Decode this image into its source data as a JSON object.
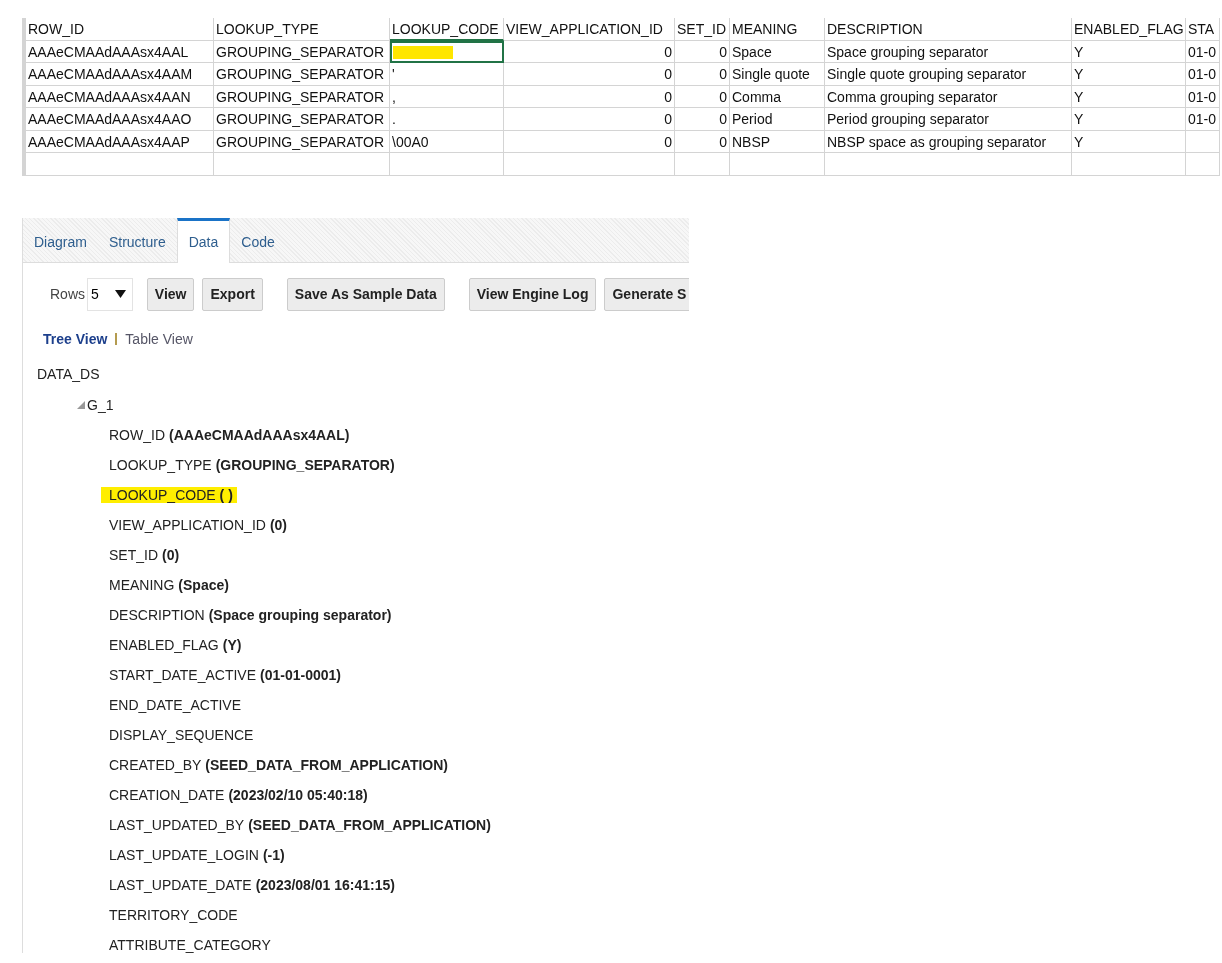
{
  "sheet": {
    "columns": [
      {
        "label": "ROW_ID",
        "kind": "text",
        "selected": false
      },
      {
        "label": "LOOKUP_TYPE",
        "kind": "text",
        "selected": false
      },
      {
        "label": "LOOKUP_CODE",
        "kind": "text",
        "selected": true
      },
      {
        "label": "VIEW_APPLICATION_ID",
        "kind": "number",
        "selected": false
      },
      {
        "label": "SET_ID",
        "kind": "number",
        "selected": false
      },
      {
        "label": "MEANING",
        "kind": "text",
        "selected": false
      },
      {
        "label": "DESCRIPTION",
        "kind": "text",
        "selected": false
      },
      {
        "label": "ENABLED_FLAG",
        "kind": "text",
        "selected": false
      },
      {
        "label": "STA",
        "kind": "text",
        "selected": false
      }
    ],
    "rows": [
      {
        "cells": [
          {
            "text": "AAAeCMAAdAAAsx4AAL",
            "selected": false,
            "highlighted": false
          },
          {
            "text": "GROUPING_SEPARATOR",
            "selected": false,
            "highlighted": false
          },
          {
            "selected": true,
            "highlighted": true
          },
          {
            "text": "0",
            "selected": false,
            "highlighted": false
          },
          {
            "text": "0",
            "selected": false,
            "highlighted": false
          },
          {
            "text": "Space",
            "selected": false,
            "highlighted": false
          },
          {
            "text": "Space grouping separator",
            "selected": false,
            "highlighted": false
          },
          {
            "text": "Y",
            "selected": false,
            "highlighted": false
          },
          {
            "text": "01-0",
            "selected": false,
            "highlighted": false
          }
        ]
      },
      {
        "cells": [
          {
            "text": "AAAeCMAAdAAAsx4AAM",
            "selected": false,
            "highlighted": false
          },
          {
            "text": "GROUPING_SEPARATOR",
            "selected": false,
            "highlighted": false
          },
          {
            "text": "'",
            "selected": false,
            "highlighted": false
          },
          {
            "text": "0",
            "selected": false,
            "highlighted": false
          },
          {
            "text": "0",
            "selected": false,
            "highlighted": false
          },
          {
            "text": "Single quote",
            "selected": false,
            "highlighted": false
          },
          {
            "text": "Single quote grouping separator",
            "selected": false,
            "highlighted": false
          },
          {
            "text": "Y",
            "selected": false,
            "highlighted": false
          },
          {
            "text": "01-0",
            "selected": false,
            "highlighted": false
          }
        ]
      },
      {
        "cells": [
          {
            "text": "AAAeCMAAdAAAsx4AAN",
            "selected": false,
            "highlighted": false
          },
          {
            "text": "GROUPING_SEPARATOR",
            "selected": false,
            "highlighted": false
          },
          {
            "text": ",",
            "selected": false,
            "highlighted": false
          },
          {
            "text": "0",
            "selected": false,
            "highlighted": false
          },
          {
            "text": "0",
            "selected": false,
            "highlighted": false
          },
          {
            "text": "Comma",
            "selected": false,
            "highlighted": false
          },
          {
            "text": "Comma grouping separator",
            "selected": false,
            "highlighted": false
          },
          {
            "text": "Y",
            "selected": false,
            "highlighted": false
          },
          {
            "text": "01-0",
            "selected": false,
            "highlighted": false
          }
        ]
      },
      {
        "cells": [
          {
            "text": "AAAeCMAAdAAAsx4AAO",
            "selected": false,
            "highlighted": false
          },
          {
            "text": "GROUPING_SEPARATOR",
            "selected": false,
            "highlighted": false
          },
          {
            "text": ".",
            "selected": false,
            "highlighted": false
          },
          {
            "text": "0",
            "selected": false,
            "highlighted": false
          },
          {
            "text": "0",
            "selected": false,
            "highlighted": false
          },
          {
            "text": "Period",
            "selected": false,
            "highlighted": false
          },
          {
            "text": "Period grouping separator",
            "selected": false,
            "highlighted": false
          },
          {
            "text": "Y",
            "selected": false,
            "highlighted": false
          },
          {
            "text": "01-0",
            "selected": false,
            "highlighted": false
          }
        ]
      },
      {
        "cells": [
          {
            "text": "AAAeCMAAdAAAsx4AAP",
            "selected": false,
            "highlighted": false
          },
          {
            "text": "GROUPING_SEPARATOR",
            "selected": false,
            "highlighted": false
          },
          {
            "text": "\\00A0",
            "selected": false,
            "highlighted": false
          },
          {
            "text": "0",
            "selected": false,
            "highlighted": false
          },
          {
            "text": "0",
            "selected": false,
            "highlighted": false
          },
          {
            "text": "NBSP",
            "selected": false,
            "highlighted": false
          },
          {
            "text": "NBSP space as grouping separator",
            "selected": false,
            "highlighted": false
          },
          {
            "text": "Y",
            "selected": false,
            "highlighted": false
          },
          {
            "selected": false,
            "highlighted": false
          }
        ]
      }
    ]
  },
  "tabs": [
    {
      "label": "Diagram",
      "selected": false
    },
    {
      "label": "Structure",
      "selected": false
    },
    {
      "label": "Data",
      "selected": true
    },
    {
      "label": "Code",
      "selected": false
    }
  ],
  "toolbar": {
    "rows_label": "Rows",
    "rows_value": "5",
    "items": [
      {
        "kind": "button",
        "label": "View"
      },
      {
        "kind": "button",
        "label": "Export"
      },
      {
        "kind": "separator"
      },
      {
        "kind": "button",
        "label": "Save As Sample Data"
      },
      {
        "kind": "separator"
      },
      {
        "kind": "button",
        "label": "View Engine Log"
      },
      {
        "kind": "button",
        "label": "Generate S"
      }
    ]
  },
  "views": [
    {
      "label": "Tree View",
      "selected": true
    },
    {
      "label": "Table View",
      "selected": false
    }
  ],
  "tree": {
    "label": "DATA_DS",
    "children": [
      {
        "label": "G_1",
        "expanded": true,
        "fields": [
          {
            "name": "ROW_ID",
            "value": "(AAAeCMAAdAAAsx4AAL)",
            "highlighted": false
          },
          {
            "name": "LOOKUP_TYPE",
            "value": "(GROUPING_SEPARATOR)",
            "highlighted": false
          },
          {
            "name": "LOOKUP_CODE",
            "value": "( )",
            "highlighted": true
          },
          {
            "name": "VIEW_APPLICATION_ID",
            "value": "(0)",
            "highlighted": false
          },
          {
            "name": "SET_ID",
            "value": "(0)",
            "highlighted": false
          },
          {
            "name": "MEANING",
            "value": "(Space)",
            "highlighted": false
          },
          {
            "name": "DESCRIPTION",
            "value": "(Space grouping separator)",
            "highlighted": false
          },
          {
            "name": "ENABLED_FLAG",
            "value": "(Y)",
            "highlighted": false
          },
          {
            "name": "START_DATE_ACTIVE",
            "value": "(01-01-0001)",
            "highlighted": false
          },
          {
            "name": "END_DATE_ACTIVE",
            "highlighted": false
          },
          {
            "name": "DISPLAY_SEQUENCE",
            "highlighted": false
          },
          {
            "name": "CREATED_BY",
            "value": "(SEED_DATA_FROM_APPLICATION)",
            "highlighted": false
          },
          {
            "name": "CREATION_DATE",
            "value": "(2023/02/10 05:40:18)",
            "highlighted": false
          },
          {
            "name": "LAST_UPDATED_BY",
            "value": "(SEED_DATA_FROM_APPLICATION)",
            "highlighted": false
          },
          {
            "name": "LAST_UPDATE_LOGIN",
            "value": "(-1)",
            "highlighted": false
          },
          {
            "name": "LAST_UPDATE_DATE",
            "value": "(2023/08/01 16:41:15)",
            "highlighted": false
          },
          {
            "name": "TERRITORY_CODE",
            "highlighted": false
          },
          {
            "name": "ATTRIBUTE_CATEGORY",
            "highlighted": false
          }
        ]
      }
    ]
  }
}
